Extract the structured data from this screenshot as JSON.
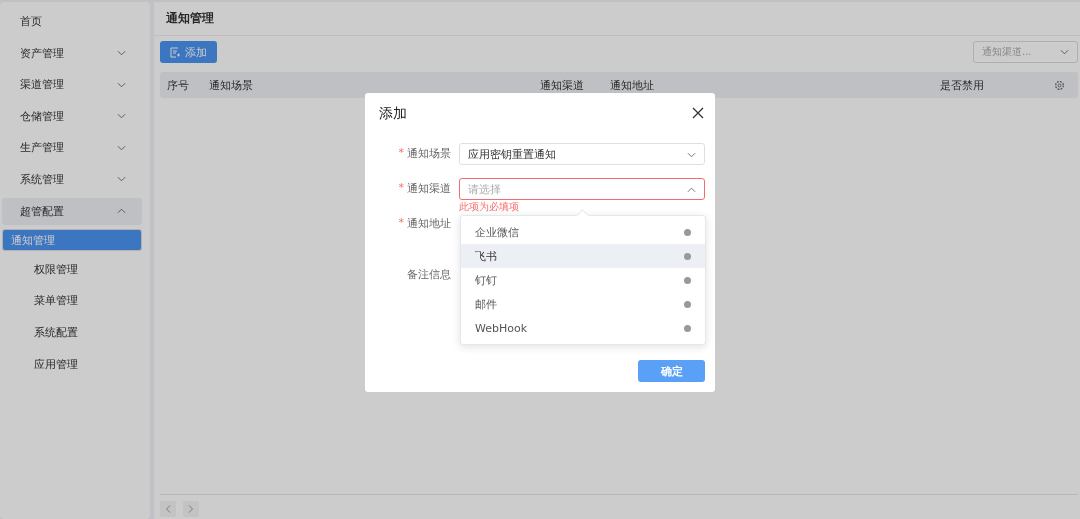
{
  "sidebar": {
    "items": [
      {
        "label": "首页"
      },
      {
        "label": "资产管理",
        "expanded": false
      },
      {
        "label": "渠道管理",
        "expanded": false
      },
      {
        "label": "仓储管理",
        "expanded": false
      },
      {
        "label": "生产管理",
        "expanded": false
      },
      {
        "label": "系统管理",
        "expanded": false
      },
      {
        "label": "超管配置",
        "expanded": true,
        "children": [
          {
            "label": "通知管理",
            "selected": true
          },
          {
            "label": "权限管理",
            "selected": false
          },
          {
            "label": "菜单管理",
            "selected": false
          },
          {
            "label": "系统配置",
            "selected": false
          },
          {
            "label": "应用管理",
            "selected": false
          }
        ]
      }
    ]
  },
  "page": {
    "title": "通知管理",
    "add_button": "添加",
    "filter": {
      "placeholder": "通知渠道..."
    },
    "table": {
      "columns": [
        "序号",
        "通知场景",
        "通知渠道",
        "通知地址",
        "是否禁用"
      ]
    }
  },
  "modal": {
    "title": "添加",
    "fields": [
      {
        "kind": "select",
        "label": "通知场景",
        "required_mark": "*",
        "value": "应用密钥重置通知"
      },
      {
        "kind": "select",
        "label": "通知渠道",
        "required_mark": "*",
        "placeholder": "请选择",
        "error": "此项为必填项",
        "open": true,
        "options": [
          {
            "label": "企业微信",
            "highlighted": false
          },
          {
            "label": "飞书",
            "highlighted": true
          },
          {
            "label": "钉钉",
            "highlighted": false
          },
          {
            "label": "邮件",
            "highlighted": false
          },
          {
            "label": "WebHook",
            "highlighted": false
          }
        ]
      },
      {
        "kind": "textarea",
        "label": "通知地址",
        "required_mark": "*"
      },
      {
        "kind": "input",
        "label": "备注信息"
      }
    ],
    "confirm": "确定"
  }
}
